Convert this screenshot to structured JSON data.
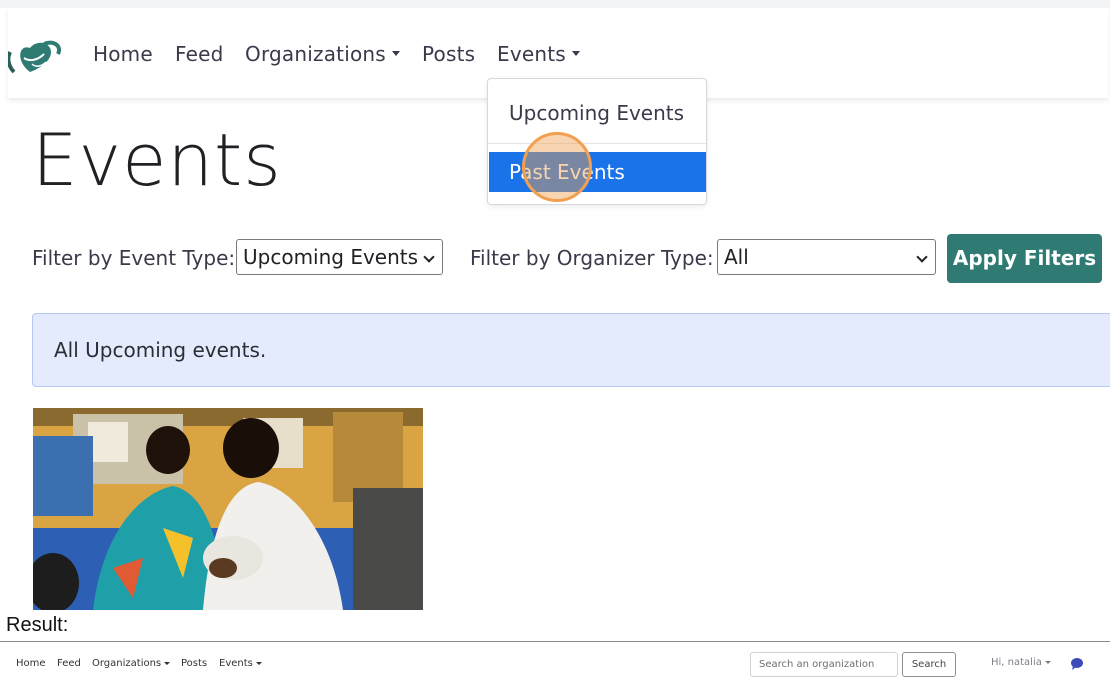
{
  "navbar": {
    "items": [
      {
        "label": "Home"
      },
      {
        "label": "Feed"
      },
      {
        "label": "Organizations"
      },
      {
        "label": "Posts"
      },
      {
        "label": "Events"
      }
    ]
  },
  "events_dropdown": {
    "items": [
      {
        "label": "Upcoming Events"
      },
      {
        "label": "Past Events"
      }
    ],
    "highlighted": "Past Events"
  },
  "page": {
    "title": "Events"
  },
  "filters": {
    "event_type_label": "Filter by Event Type:",
    "event_type_value": "Upcoming Events",
    "organizer_type_label": "Filter by Organizer Type:",
    "organizer_type_value": "All",
    "apply_label": "Apply Filters"
  },
  "alert": {
    "text": "All Upcoming events."
  },
  "result": {
    "label": "Result:",
    "nav_items": [
      {
        "label": "Home"
      },
      {
        "label": "Feed"
      },
      {
        "label": "Organizations"
      },
      {
        "label": "Posts"
      },
      {
        "label": "Events"
      }
    ],
    "search_placeholder": "Search an organization",
    "search_button": "Search",
    "greeting": "Hi, natalia"
  },
  "colors": {
    "accent_teal": "#2f7b74",
    "highlight_blue": "#1a73e8",
    "alert_bg": "#e4ebfc",
    "click_marker": "#f0a050"
  },
  "icons": {
    "brand": "heart-hands-logo-icon",
    "chat": "chat-bubble-icon"
  }
}
